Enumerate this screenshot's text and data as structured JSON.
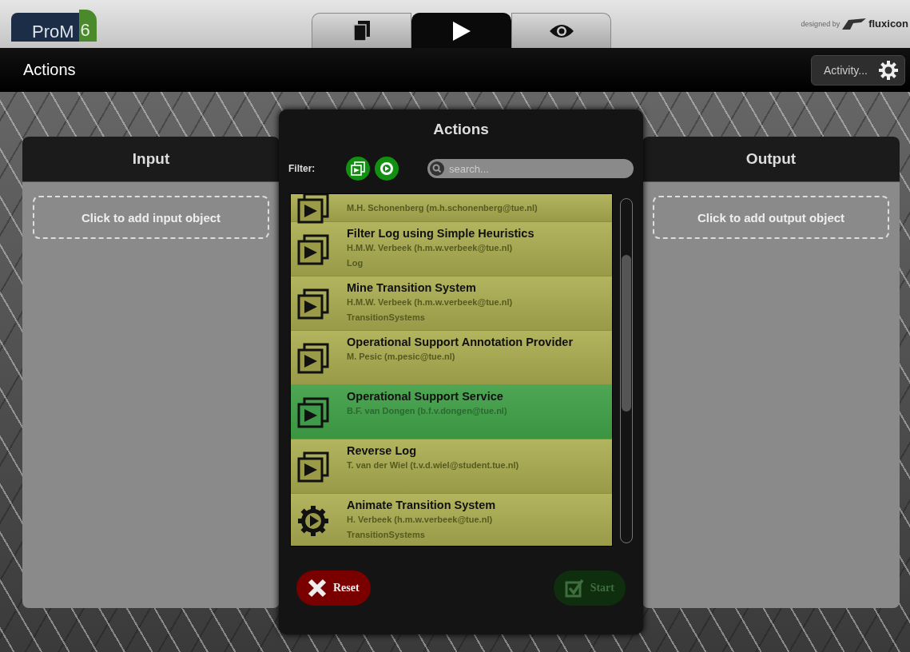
{
  "header": {
    "logo": "ProM",
    "version": "6",
    "credit": "designed by",
    "brand": "fluxicon"
  },
  "tabs": [
    {
      "kind": "workspace",
      "selected": false
    },
    {
      "kind": "actions",
      "selected": true
    },
    {
      "kind": "views",
      "selected": false
    }
  ],
  "toolbar": {
    "title": "Actions",
    "activity_button": "Activity..."
  },
  "input_panel": {
    "title": "Input",
    "add_label": "Click to add input object"
  },
  "output_panel": {
    "title": "Output",
    "add_label": "Click to add output object"
  },
  "dialog": {
    "title": "Actions",
    "filter_label": "Filter:",
    "filters": [
      {
        "kind": "plugin",
        "on": true
      },
      {
        "kind": "visualizer",
        "on": true
      }
    ],
    "search": {
      "placeholder": "search..."
    },
    "items": [
      {
        "kind": "plugin",
        "author": "M.H. Schonenberg (m.h.schonenberg@tue.nl)",
        "selected": false
      },
      {
        "kind": "plugin",
        "title": "Filter Log using Simple Heuristics",
        "author": "H.M.W. Verbeek (h.m.w.verbeek@tue.nl)",
        "type": "Log",
        "selected": false
      },
      {
        "kind": "plugin",
        "title": "Mine Transition System",
        "author": "H.M.W. Verbeek (h.m.w.verbeek@tue.nl)",
        "type": "TransitionSystems",
        "selected": false
      },
      {
        "kind": "plugin",
        "title": "Operational Support Annotation Provider",
        "author": "M. Pesic (m.pesic@tue.nl)",
        "selected": false
      },
      {
        "kind": "plugin",
        "title": "Operational Support Service",
        "author": "B.F. van Dongen (b.f.v.dongen@tue.nl)",
        "selected": true
      },
      {
        "kind": "plugin",
        "title": "Reverse Log",
        "author": "T. van der Wiel (t.v.d.wiel@student.tue.nl)",
        "selected": false
      },
      {
        "kind": "visualizer",
        "title": "Animate Transition System",
        "author": "H. Verbeek (h.m.w.verbeek@tue.nl)",
        "type": "TransitionSystems",
        "selected": false
      }
    ],
    "reset_button": "Reset",
    "start_button": {
      "label": "Start",
      "disabled": true
    }
  }
}
